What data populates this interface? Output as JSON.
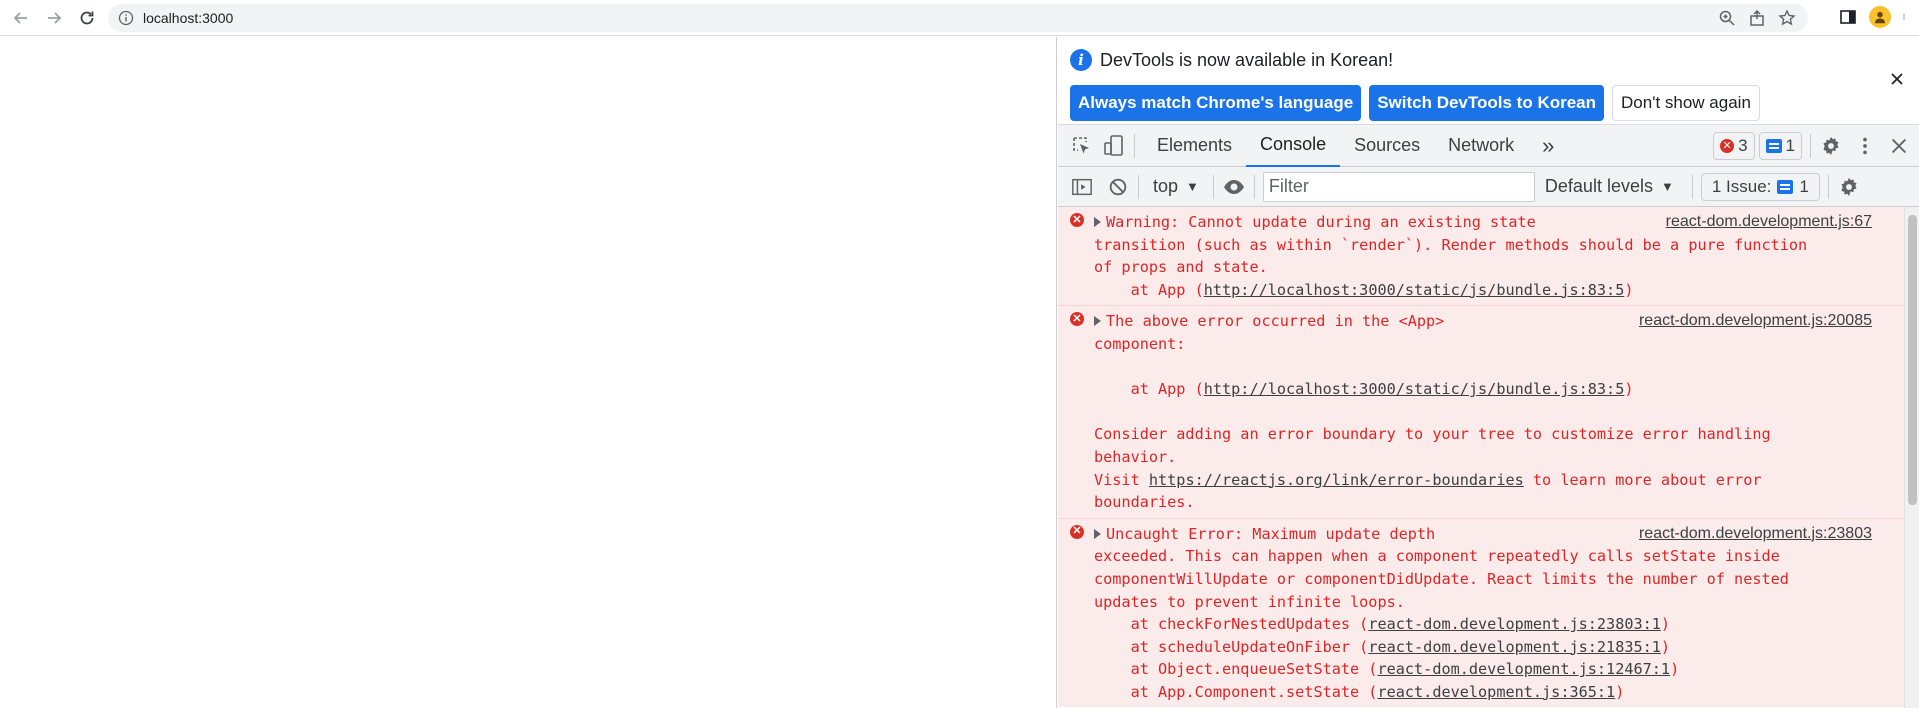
{
  "browser": {
    "url": "localhost:3000"
  },
  "infobar": {
    "message": "DevTools is now available in Korean!",
    "btn_match": "Always match Chrome's language",
    "btn_switch": "Switch DevTools to Korean",
    "btn_dont_show": "Don't show again"
  },
  "tabs": {
    "elements": "Elements",
    "console": "Console",
    "sources": "Sources",
    "network": "Network",
    "more": "»",
    "error_count": "3",
    "msg_count": "1"
  },
  "toolbar": {
    "context": "top",
    "filter_placeholder": "Filter",
    "levels": "Default levels",
    "issues_label": "1 Issue:",
    "issues_count": "1"
  },
  "console": {
    "entry1": {
      "source": "react-dom.development.js:67",
      "l1": "Warning: Cannot update during an existing state",
      "l2": "transition (such as within `render`). Render methods should be a pure function",
      "l3": "of props and state.",
      "l4_prefix": "    at App (",
      "l4_link": "http://localhost:3000/static/js/bundle.js:83:5",
      "l4_suffix": ")"
    },
    "entry2": {
      "source": "react-dom.development.js:20085",
      "l1": "The above error occurred in the <App>",
      "l2": "component:",
      "l4_prefix": "    at App (",
      "l4_link": "http://localhost:3000/static/js/bundle.js:83:5",
      "l4_suffix": ")",
      "l6": "Consider adding an error boundary to your tree to customize error handling",
      "l7": "behavior.",
      "l8_prefix": "Visit ",
      "l8_link": "https://reactjs.org/link/error-boundaries",
      "l8_suffix": " to learn more about error",
      "l9": "boundaries."
    },
    "entry3": {
      "source": "react-dom.development.js:23803",
      "l1": "Uncaught Error: Maximum update depth",
      "l2": "exceeded. This can happen when a component repeatedly calls setState inside",
      "l3": "componentWillUpdate or componentDidUpdate. React limits the number of nested",
      "l4": "updates to prevent infinite loops.",
      "s1_prefix": "    at checkForNestedUpdates (",
      "s1_link": "react-dom.development.js:23803:1",
      "s2_prefix": "    at scheduleUpdateOnFiber (",
      "s2_link": "react-dom.development.js:21835:1",
      "s3_prefix": "    at Object.enqueueSetState (",
      "s3_link": "react-dom.development.js:12467:1",
      "s4_prefix": "    at App.Component.setState (",
      "s4_link": "react.development.js:365:1",
      "close_paren": ")"
    }
  }
}
